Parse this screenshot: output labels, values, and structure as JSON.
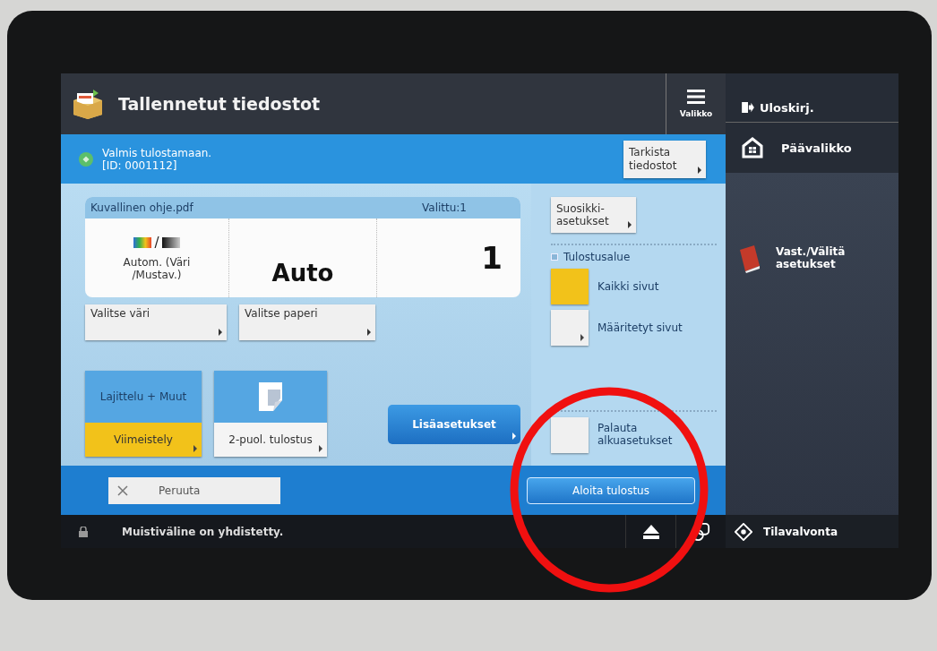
{
  "header": {
    "title": "Tallennetut tiedostot",
    "menu_button": "Valikko"
  },
  "status": {
    "message": "Valmis tulostamaan.",
    "id": "[ID: 0001112]",
    "check_button": "Tarkista tiedostot"
  },
  "file_card": {
    "name": "Kuvallinen ohje.pdf",
    "selected_count": "Valittu:1",
    "color_separator": "/",
    "color_mode": "Autom. (Väri /Mustav.)",
    "paper": "Auto",
    "copies": "1"
  },
  "setting_buttons": [
    "Valitse väri",
    "Valitse paperi"
  ],
  "tiles": [
    {
      "kind": "split",
      "top": "Lajittelu + Muut",
      "bottom": "Viimeistely"
    },
    {
      "kind": "icon",
      "label": "2-puol. tulostus"
    }
  ],
  "more_button": "Lisäasetukset",
  "favorites_button": "Suosikki-asetukset",
  "print_range": {
    "title": "Tulostusalue",
    "options": [
      {
        "label": "Kaikki sivut",
        "selected": true,
        "submenu": false
      },
      {
        "label": "Määritetyt sivut",
        "selected": false,
        "submenu": true
      }
    ]
  },
  "reset_button": "Palauta alkuasetukset",
  "cancel_button": "Peruuta",
  "start_button": "Aloita tulostus",
  "sidebar": {
    "logout": "Uloskirj.",
    "main_menu": "Päävalikko",
    "items": [
      "Vast./Välitä asetukset"
    ]
  },
  "status_bar": {
    "message": "Muistiväline on yhdistetty.",
    "monitor": "Tilavalvonta"
  }
}
